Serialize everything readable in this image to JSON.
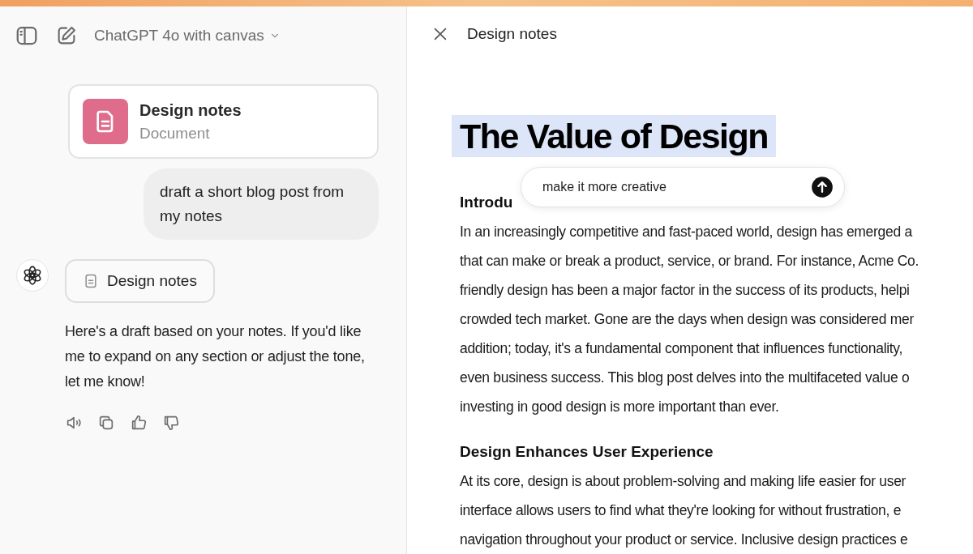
{
  "chat": {
    "model_name": "ChatGPT 4o with canvas",
    "document_card": {
      "title": "Design notes",
      "subtitle": "Document"
    },
    "user_message": "draft a short blog post from my notes",
    "assistant": {
      "doc_chip": "Design notes",
      "reply": "Here's a draft based on your notes. If you'd like me to expand on any section or adjust the tone, let me know!"
    }
  },
  "canvas": {
    "title": "Design notes",
    "heading": "The Value of Design",
    "heading_selected": true,
    "edit_prompt": {
      "value": "make it more creative"
    },
    "sections": [
      {
        "heading": "Introdu",
        "lines": [
          "In an increasingly competitive and fast-paced world, design has emerged a",
          "that can make or break a product, service, or brand. For instance, Acme Co.",
          "friendly design has been a major factor in the success of its products, helpi",
          "crowded tech market. Gone are the days when design was considered mer",
          "addition; today, it's a fundamental component that influences functionality,",
          "even business success. This blog post delves into the multifaceted value o",
          "investing in good design is more important than ever."
        ]
      },
      {
        "heading": "Design Enhances User Experience",
        "lines": [
          "At its core, design is about problem-solving and making life easier for user",
          "interface allows users to find what they're looking for without frustration, e",
          "navigation throughout your product or service. Inclusive design practices e"
        ]
      }
    ]
  }
}
